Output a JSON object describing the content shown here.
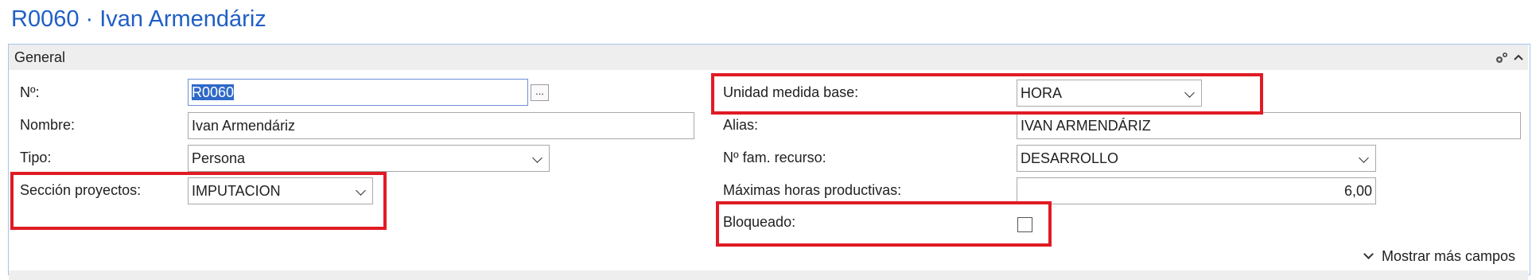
{
  "page": {
    "title": "R0060 · Ivan Armendáriz"
  },
  "section": {
    "title": "General",
    "header_icons": {
      "settings": "gear-icon",
      "collapse": "chevron-up-icon"
    },
    "show_more_label": "Mostrar más campos"
  },
  "fields": {
    "no": {
      "label": "Nº:",
      "value": "R0060",
      "assist_label": "..."
    },
    "nombre": {
      "label": "Nombre:",
      "value": "Ivan Armendáriz"
    },
    "tipo": {
      "label": "Tipo:",
      "value": "Persona"
    },
    "seccion": {
      "label": "Sección proyectos:",
      "value": "IMPUTACION"
    },
    "unidad": {
      "label": "Unidad medida base:",
      "value": "HORA"
    },
    "alias": {
      "label": "Alias:",
      "value": "IVAN ARMENDÁRIZ"
    },
    "fam": {
      "label": "Nº fam. recurso:",
      "value": "DESARROLLO"
    },
    "horas": {
      "label": "Máximas horas productivas:",
      "value": "6,00"
    },
    "bloqueado": {
      "label": "Bloqueado:",
      "checked": false
    }
  },
  "colors": {
    "title": "#1f5fc6",
    "highlight": "#e01b24",
    "selection": "#2f68c8"
  }
}
